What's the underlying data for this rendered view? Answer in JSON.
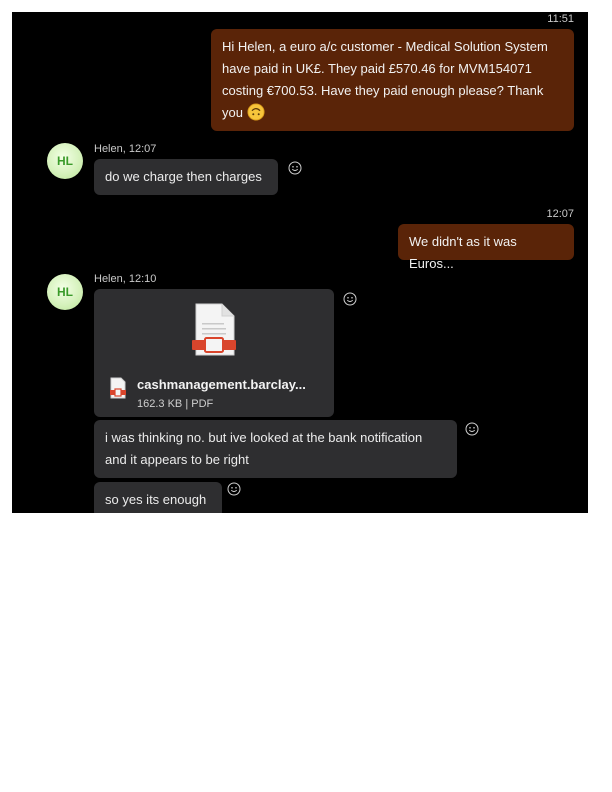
{
  "messages": {
    "m1": {
      "time": "11:51",
      "line1": "Hi Helen, a euro a/c customer - Medical Solution System",
      "line2": "have paid in UK£.  They paid £570.46 for MVM154071",
      "line3": "costing €700.53.  Have they paid enough please?  Thank",
      "line4": "you"
    },
    "m2": {
      "avatar": "HL",
      "meta": "Helen, 12:07",
      "text": "do we charge then charges"
    },
    "m3": {
      "time": "12:07",
      "text": "We didn't as it was Euros..."
    },
    "m4": {
      "avatar": "HL",
      "meta": "Helen, 12:10",
      "file_name": "cashmanagement.barclay...",
      "file_size": "162.3 KB",
      "file_type": "PDF"
    },
    "m5": {
      "line1": "i was thinking no. but ive looked at the bank notification",
      "line2": "and it appears to be right"
    },
    "m6": {
      "text": "so yes its enough"
    }
  },
  "colors": {
    "background": "#000000",
    "sent_bubble": "#5a2408",
    "received_bubble": "#2e2e30",
    "avatar_text": "#3a9b2a"
  },
  "icons": {
    "reaction": "smiley-react-icon",
    "emoji": "upside-down-face-emoji",
    "file": "pdf-document-icon"
  }
}
